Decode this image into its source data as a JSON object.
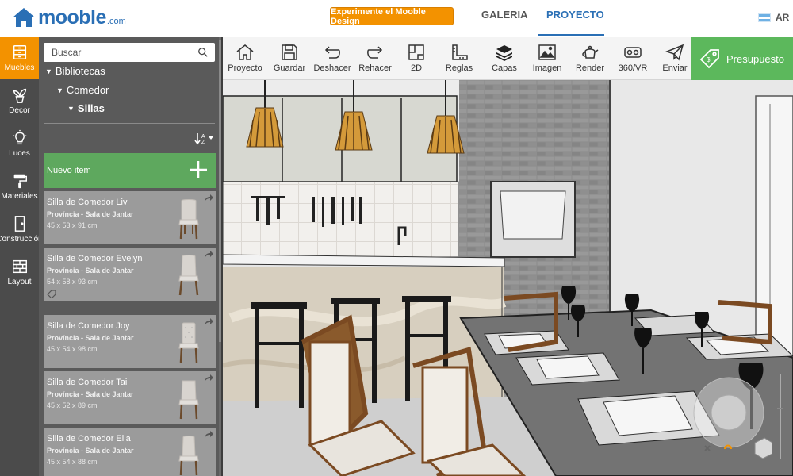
{
  "header": {
    "logo_text": "mooble",
    "logo_suffix": ".com",
    "try_button": "Experimente el Mooble Design",
    "tabs": [
      {
        "label": "GALERIA"
      },
      {
        "label": "PROYECTO"
      }
    ],
    "language": "AR"
  },
  "sidebar": {
    "items": [
      {
        "label": "Muebles",
        "icon": "cabinet-icon"
      },
      {
        "label": "Decor",
        "icon": "plant-icon"
      },
      {
        "label": "Luces",
        "icon": "bulb-icon"
      },
      {
        "label": "Materiales",
        "icon": "paint-roller-icon"
      },
      {
        "label": "Construcción",
        "icon": "door-icon"
      },
      {
        "label": "Layout",
        "icon": "brick-wall-icon"
      }
    ]
  },
  "library": {
    "search_placeholder": "Buscar",
    "tree": [
      {
        "label": "Bibliotecas"
      },
      {
        "label": "Comedor"
      },
      {
        "label": "Sillas"
      }
    ],
    "new_item_label": "Nuevo item",
    "items": [
      {
        "name": "Silla de Comedor Liv",
        "sub": "Província - Sala de Jantar",
        "dims": "45 x 53 x 91 cm"
      },
      {
        "name": "Silla de Comedor Evelyn",
        "sub": "Província - Sala de Jantar",
        "dims": "54 x 58 x 93 cm"
      },
      {
        "name": "Silla de Comedor Joy",
        "sub": "Província - Sala de Jantar",
        "dims": "45 x 54 x 98 cm"
      },
      {
        "name": "Silla de Comedor Tai",
        "sub": "Província - Sala de Jantar",
        "dims": "45 x 52 x 89 cm"
      },
      {
        "name": "Silla de Comedor Ella",
        "sub": "Província - Sala de Jantar",
        "dims": "45 x 54 x 88 cm"
      }
    ]
  },
  "toolbar": {
    "tools": [
      {
        "label": "Proyecto",
        "icon": "home-icon"
      },
      {
        "label": "Guardar",
        "icon": "save-icon"
      },
      {
        "label": "Deshacer",
        "icon": "undo-icon"
      },
      {
        "label": "Rehacer",
        "icon": "redo-icon"
      },
      {
        "label": "2D",
        "icon": "plan-2d-icon"
      },
      {
        "label": "Reglas",
        "icon": "ruler-icon"
      },
      {
        "label": "Capas",
        "icon": "layers-icon"
      },
      {
        "label": "Imagen",
        "icon": "image-icon"
      },
      {
        "label": "Render",
        "icon": "teapot-icon"
      },
      {
        "label": "360/VR",
        "icon": "vr-headset-icon"
      },
      {
        "label": "Enviar",
        "icon": "paper-plane-icon"
      }
    ],
    "budget_label": "Presupuesto"
  },
  "colors": {
    "brand_blue": "#2a6fb5",
    "accent_orange": "#f39200",
    "budget_green": "#5cb85c",
    "sidebar_dark": "#4b4b4b",
    "panel_gray": "#5a5a5a"
  }
}
